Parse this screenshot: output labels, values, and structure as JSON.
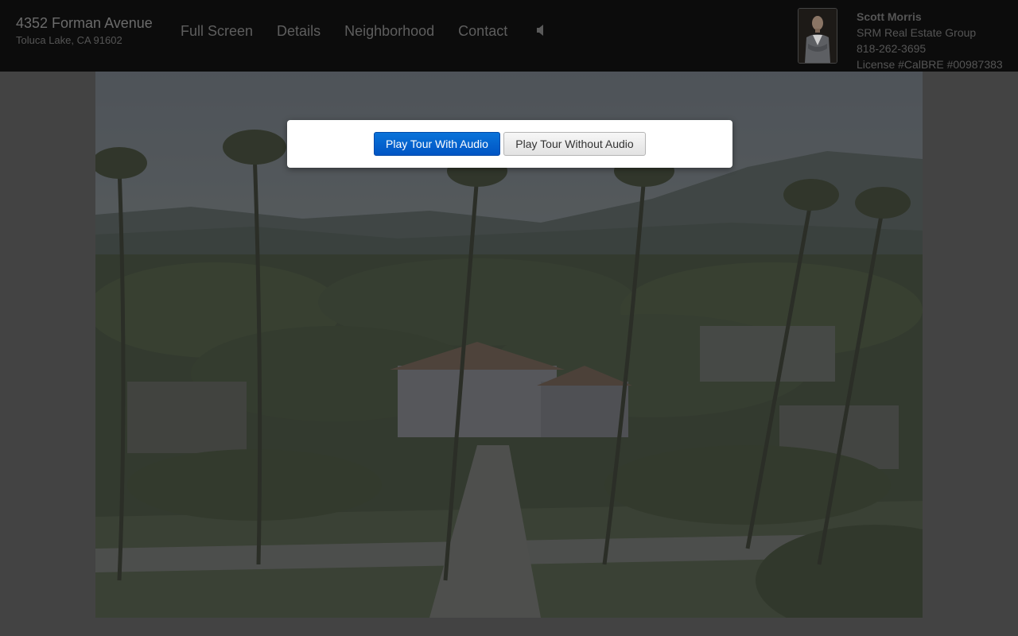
{
  "header": {
    "address_line1": "4352 Forman Avenue",
    "address_line2": "Toluca Lake, CA 91602",
    "nav": {
      "full_screen": "Full Screen",
      "details": "Details",
      "neighborhood": "Neighborhood",
      "contact": "Contact"
    },
    "audio_icon": "speaker-icon"
  },
  "agent": {
    "name": "Scott Morris",
    "company": "SRM Real Estate Group",
    "phone": "818-262-3695",
    "license": "License #CalBRE #00987383"
  },
  "modal": {
    "play_with_audio": "Play Tour With Audio",
    "play_without_audio": "Play Tour Without Audio"
  },
  "colors": {
    "header_bg": "#0c0c0c",
    "primary_button": "#0a6fd6",
    "page_bg": "#434343"
  }
}
